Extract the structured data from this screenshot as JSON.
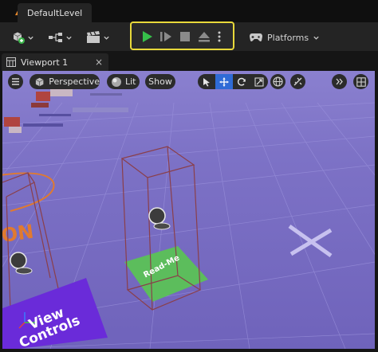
{
  "window": {
    "level_name": "DefaultLevel"
  },
  "toolbar": {
    "platforms_label": "Platforms"
  },
  "viewport_tab": {
    "label": "Viewport 1",
    "close_label": "×"
  },
  "viewport_toolbar": {
    "perspective_label": "Perspective",
    "lit_label": "Lit",
    "show_label": "Show"
  },
  "scene": {
    "readme_label": "Read-Me",
    "view_controls_line1": "View",
    "view_controls_line2": "Controls",
    "floor_text": "ON"
  },
  "colors": {
    "play_group_border": "#e8d83a",
    "play_green": "#36c04a",
    "viewport_purple": "#7a6fc2",
    "active_transform": "#2f6bd6",
    "readme_plane": "#5cbd5c",
    "view_controls_plane": "#6a2bd9",
    "floor_orange": "#e07a30"
  }
}
